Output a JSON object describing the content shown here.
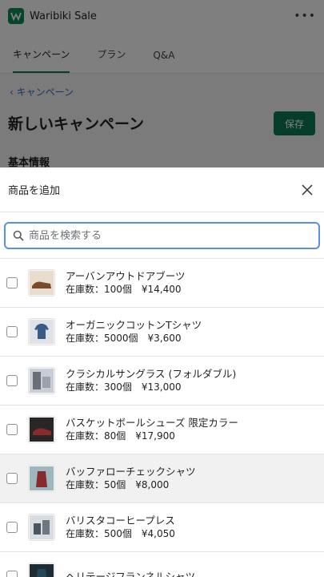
{
  "app": {
    "title": "Waribiki Sale",
    "more_label": "•••",
    "tabs": [
      {
        "label": "キャンペーン"
      },
      {
        "label": "プラン"
      },
      {
        "label": "Q&A"
      }
    ],
    "back_label": "キャンペーン",
    "page_title": "新しいキャンペーン",
    "save_label": "保存",
    "section_peek": "基本情報"
  },
  "sheet": {
    "title": "商品を追加",
    "search_placeholder": "商品を検索する",
    "products": [
      {
        "name": "アーバンアウトドアブーツ",
        "meta": "在庫数：100個　¥14,400",
        "thumb_color": "#7a4a2a"
      },
      {
        "name": "オーガニックコットンTシャツ",
        "meta": "在庫数：5000個　¥3,600",
        "thumb_color": "#3b5b87"
      },
      {
        "name": "クラシカルサングラス (フォルダブル)",
        "meta": "在庫数：300個　¥13,000",
        "thumb_color": "#6a6f78"
      },
      {
        "name": "バスケットボールシューズ 限定カラー",
        "meta": "在庫数：80個　¥17,900",
        "thumb_color": "#5a1f1f"
      },
      {
        "name": "バッファローチェックシャツ",
        "meta": "在庫数：50個　¥8,000",
        "thumb_color": "#8a2b2b"
      },
      {
        "name": "バリスタコーヒープレス",
        "meta": "在庫数：500個　¥4,050",
        "thumb_color": "#4a5560"
      },
      {
        "name": "ヘリテージフランネルシャツ",
        "meta": "",
        "thumb_color": "#24465a"
      }
    ]
  },
  "colors": {
    "accent": "#0a7a55",
    "link": "#2c6ecb",
    "focus": "#5b8def"
  }
}
